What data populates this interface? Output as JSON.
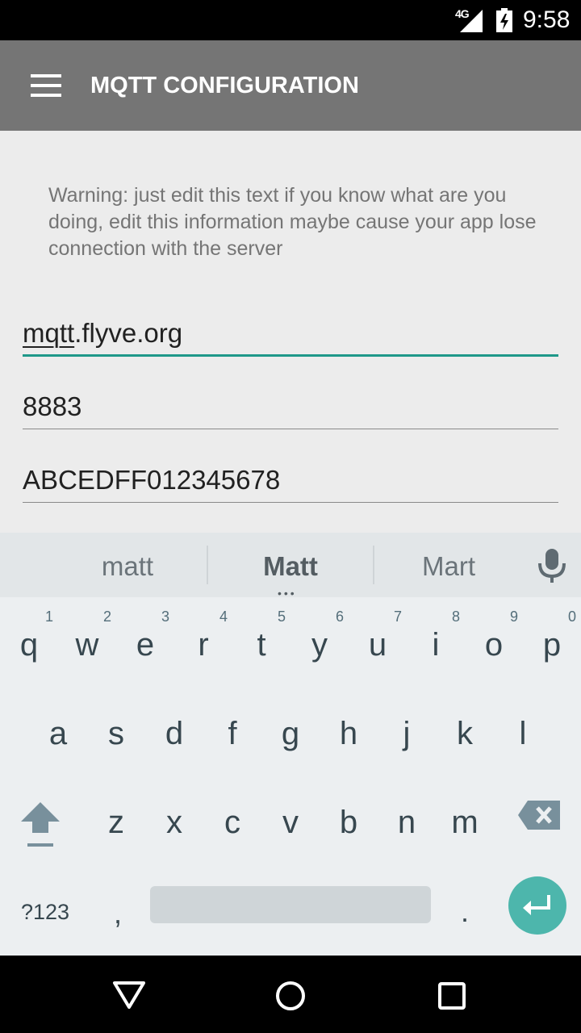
{
  "status_bar": {
    "network": "4G",
    "time": "9:58",
    "icons": [
      "signal-icon",
      "battery-charging-icon"
    ]
  },
  "app_bar": {
    "title": "MQTT CONFIGURATION",
    "menu_icon": "menu-icon"
  },
  "form": {
    "warning": "Warning: just edit this text if you know what are you doing, edit this information maybe cause your app lose connection with the server",
    "host_underlined": "mqtt",
    "host_rest": ".flyve.org",
    "port": "8883",
    "topic": "ABCEDFF012345678"
  },
  "keyboard": {
    "suggestions": [
      "matt",
      "Matt",
      "Mart"
    ],
    "row1": [
      {
        "ch": "q",
        "hint": "1"
      },
      {
        "ch": "w",
        "hint": "2"
      },
      {
        "ch": "e",
        "hint": "3"
      },
      {
        "ch": "r",
        "hint": "4"
      },
      {
        "ch": "t",
        "hint": "5"
      },
      {
        "ch": "y",
        "hint": "6"
      },
      {
        "ch": "u",
        "hint": "7"
      },
      {
        "ch": "i",
        "hint": "8"
      },
      {
        "ch": "o",
        "hint": "9"
      },
      {
        "ch": "p",
        "hint": "0"
      }
    ],
    "row2": [
      "a",
      "s",
      "d",
      "f",
      "g",
      "h",
      "j",
      "k",
      "l"
    ],
    "row3": [
      "z",
      "x",
      "c",
      "v",
      "b",
      "n",
      "m"
    ],
    "symbols_label": "?123",
    "comma": ",",
    "period": ".",
    "accent_color": "#4db6ac"
  },
  "colors": {
    "app_bar": "#757575",
    "focus_line": "#1e9889"
  }
}
